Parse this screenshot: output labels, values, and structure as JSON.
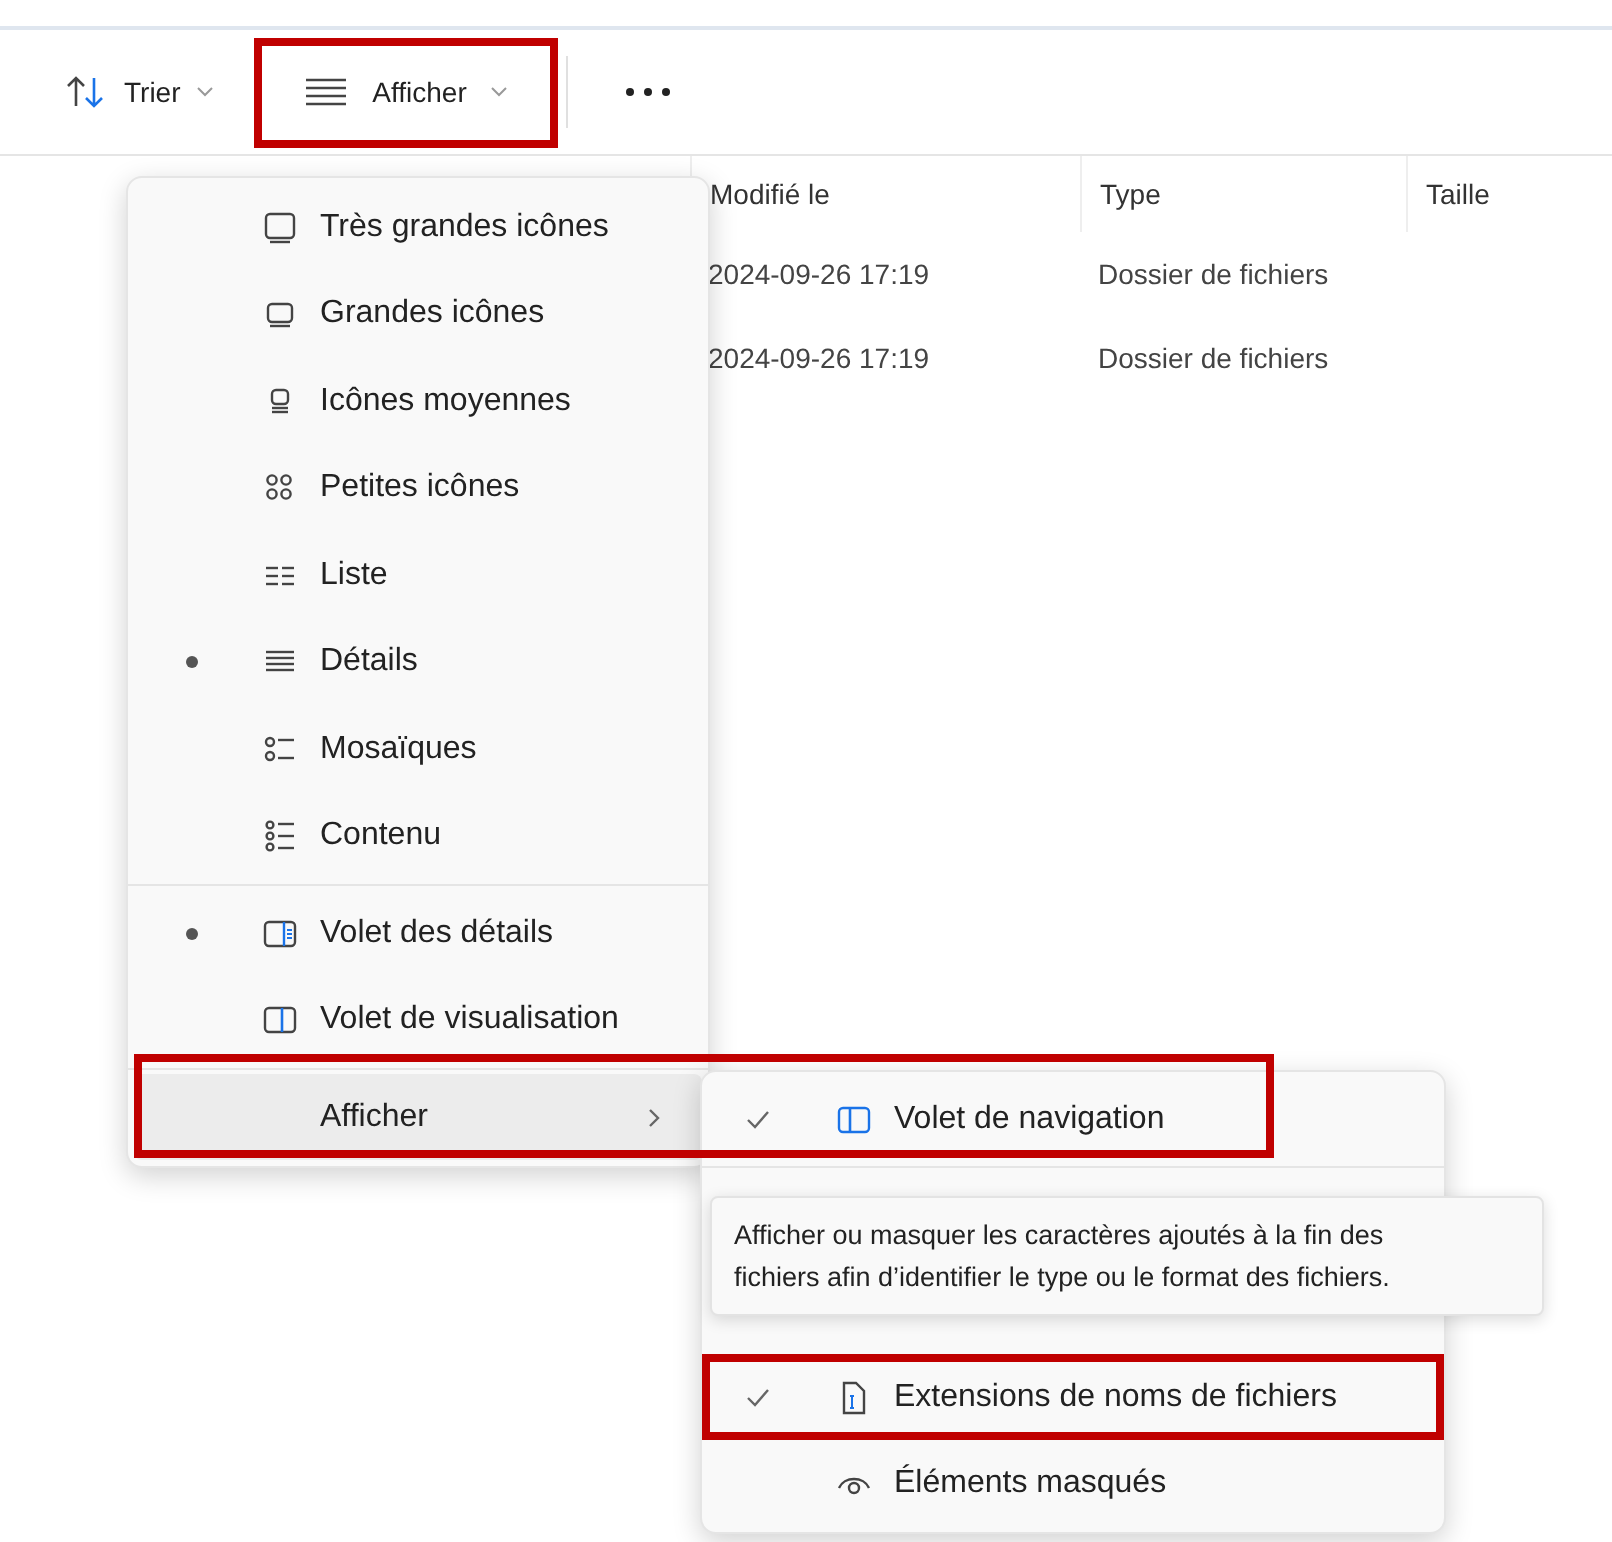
{
  "toolbar": {
    "items": [
      {
        "kind": "sort",
        "label": "Trier",
        "highlighted": false
      },
      {
        "kind": "view",
        "label": "Afficher",
        "highlighted": true
      },
      {
        "kind": "more",
        "highlighted": false
      }
    ]
  },
  "columns": [
    "Modifié le",
    "Type",
    "Taille"
  ],
  "rows": [
    {
      "modified": "2024-09-26 17:19",
      "type": "Dossier de fichiers"
    },
    {
      "modified": "2024-09-26 17:19",
      "type": "Dossier de fichiers"
    }
  ],
  "view_menu": {
    "layouts": [
      {
        "label": "Très grandes icônes",
        "selected": false
      },
      {
        "label": "Grandes icônes",
        "selected": false
      },
      {
        "label": "Icônes moyennes",
        "selected": false
      },
      {
        "label": "Petites icônes",
        "selected": false
      },
      {
        "label": "Liste",
        "selected": false
      },
      {
        "label": "Détails",
        "selected": true
      },
      {
        "label": "Mosaïques",
        "selected": false
      },
      {
        "label": "Contenu",
        "selected": false
      }
    ],
    "panes": [
      {
        "label": "Volet des détails",
        "selected": true
      },
      {
        "label": "Volet de visualisation",
        "selected": false
      }
    ],
    "show": {
      "label": "Afficher",
      "expanded": true,
      "highlighted": true
    }
  },
  "show_menu": {
    "items": [
      {
        "label": "Volet de navigation",
        "checked": true,
        "highlighted": false
      },
      {
        "label": "Extensions de noms de fichiers",
        "checked": true,
        "highlighted": true
      },
      {
        "label": "Éléments masqués",
        "checked": false,
        "highlighted": false
      }
    ]
  },
  "tooltip": {
    "text": "Afficher ou masquer les caractères ajoutés à la fin des fichiers afin d’identifier le type ou le format des fichiers."
  }
}
